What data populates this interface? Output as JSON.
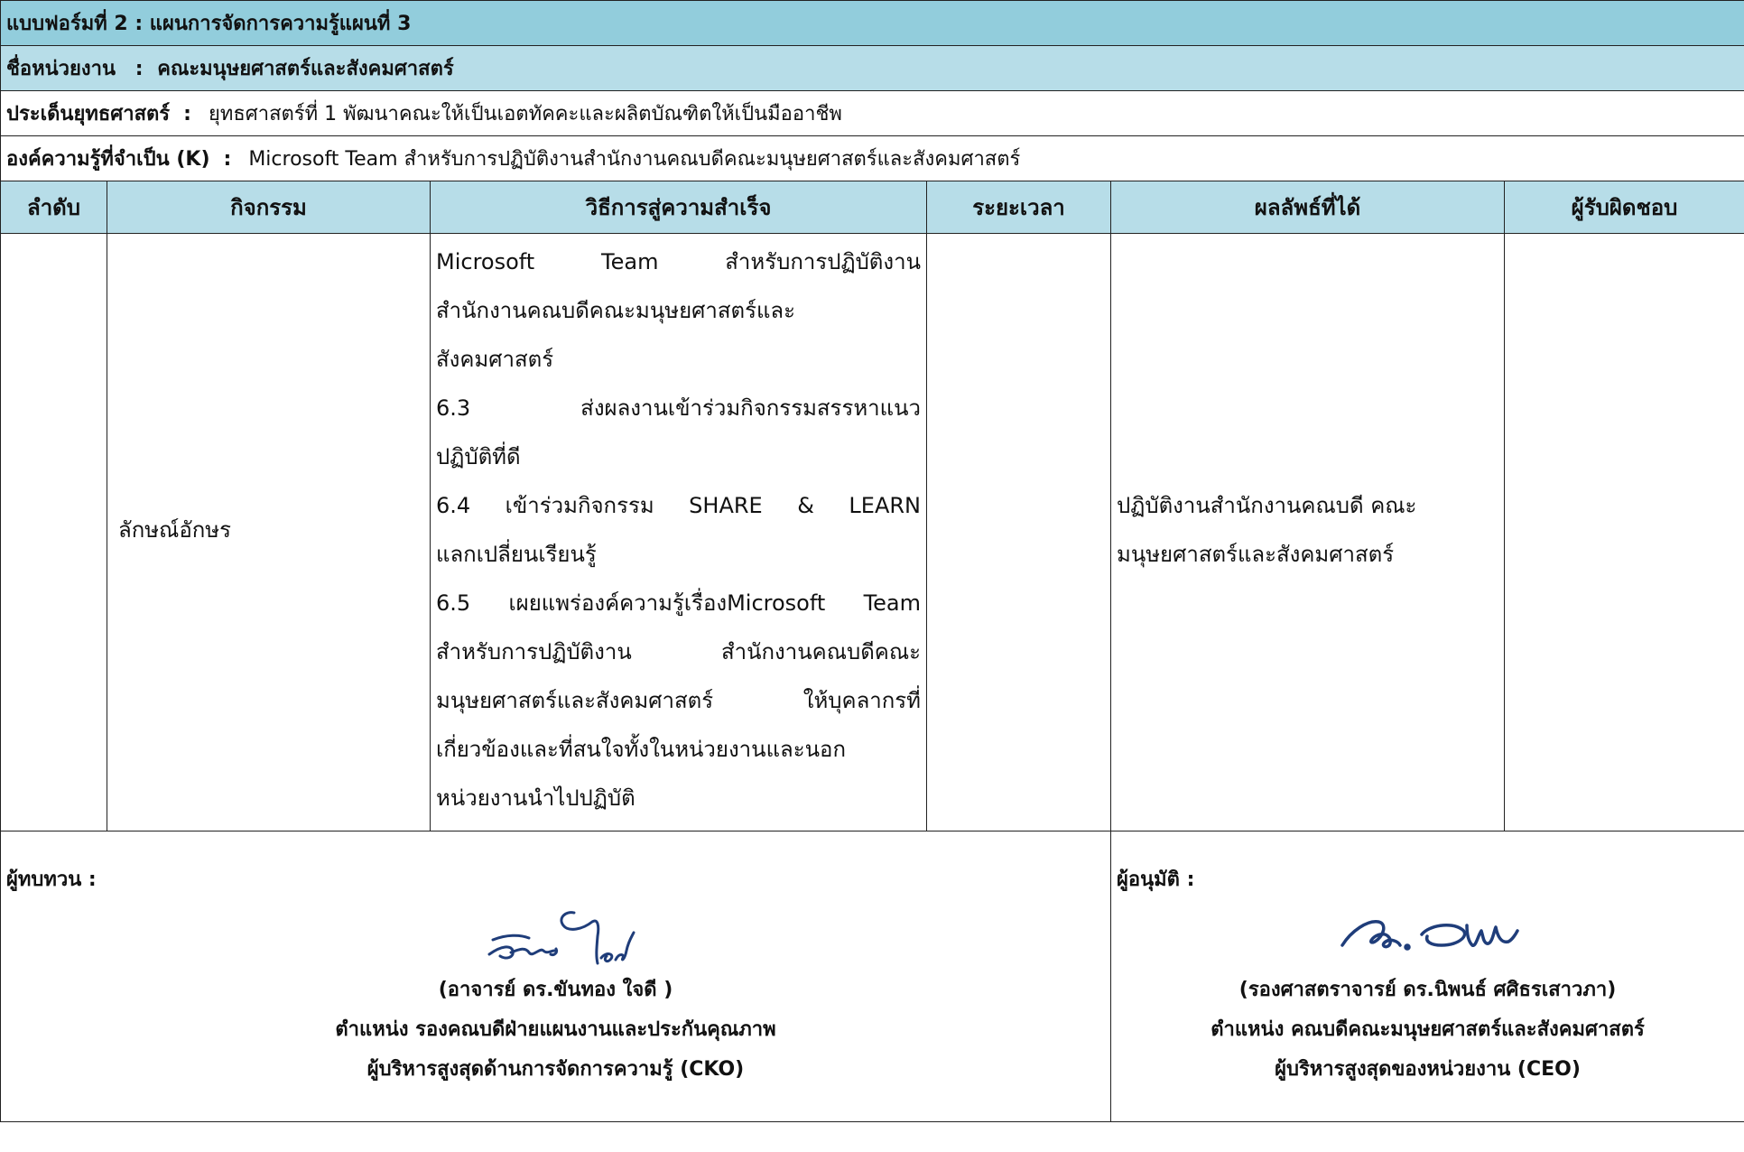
{
  "header": {
    "form_title": "แบบฟอร์มที่ 2 : แผนการจัดการความรู้แผนที่ 3",
    "department_label": "ชื่อหน่วยงาน",
    "department_sep": ":",
    "department_value": "คณะมนุษยศาสตร์และสังคมศาสตร์",
    "strategy_label": "ประเด็นยุทธศาสตร์",
    "strategy_sep": ":",
    "strategy_value": "ยุทธศาสตร์ที่ 1 พัฒนาคณะให้เป็นเอตทัคคะและผลิตบัณฑิตให้เป็นมืออาชีพ",
    "knowledge_label": "องค์ความรู้ที่จำเป็น (K)",
    "knowledge_sep": ":",
    "knowledge_value": "Microsoft Team สำหรับการปฏิบัติงานสำนักงานคณบดีคณะมนุษยศาสตร์และสังคมศาสตร์"
  },
  "table": {
    "columns": [
      "ลำดับ",
      "กิจกรรม",
      "วิธีการสู่ความสำเร็จ",
      "ระยะเวลา",
      "ผลลัพธ์ที่ได้",
      "ผู้รับผิดชอบ"
    ],
    "row": {
      "order": "",
      "activity": "ลักษณ์อักษร",
      "method_lines": [
        "Microsoft Team สำหรับการปฏิบัติงาน",
        "สำนักงานคณบดีคณะมนุษยศาสตร์และ",
        "สังคมศาสตร์",
        "6.3 ส่งผลงานเข้าร่วมกิจกรรมสรรหาแนว",
        "ปฏิบัติที่ดี",
        "6.4 เข้าร่วมกิจกรรม SHARE & LEARN",
        "แลกเปลี่ยนเรียนรู้",
        "6.5 เผยแพร่องค์ความรู้เรื่องMicrosoft Team",
        "สำหรับการปฏิบัติงาน สำนักงานคณบดีคณะ",
        "มนุษยศาสตร์และสังคมศาสตร์ ให้บุคลากรที่",
        "เกี่ยวข้องและที่สนใจทั้งในหน่วยงานและนอก",
        "หน่วยงานนำไปปฏิบัติ"
      ],
      "duration": "",
      "result_lines": [
        "ปฏิบัติงานสำนักงานคณบดี คณะ",
        "มนุษยศาสตร์และสังคมศาสตร์"
      ],
      "responsible": ""
    }
  },
  "signatures": {
    "reviewer": {
      "label": "ผู้ทบทวน :",
      "name": "(อาจารย์ ดร.ขันทอง  ใจดี )",
      "position": "ตำแหน่ง รองคณบดีฝ่ายแผนงานและประกันคุณภาพ",
      "role": "ผู้บริหารสูงสุดด้านการจัดการความรู้ (CKO)"
    },
    "approver": {
      "label": "ผู้อนุมัติ :",
      "name": "(รองศาสตราจารย์ ดร.นิพนธ์ ศศิธรเสาวภา)",
      "position": "ตำแหน่ง คณบดีคณะมนุษยศาสตร์และสังคมศาสตร์",
      "role": "ผู้บริหารสูงสุดของหน่วยงาน (CEO)"
    }
  },
  "colors": {
    "title_bg": "#92cddc",
    "header_bg": "#b7dde8",
    "border": "#222222",
    "ink": "#1f3d7a"
  }
}
